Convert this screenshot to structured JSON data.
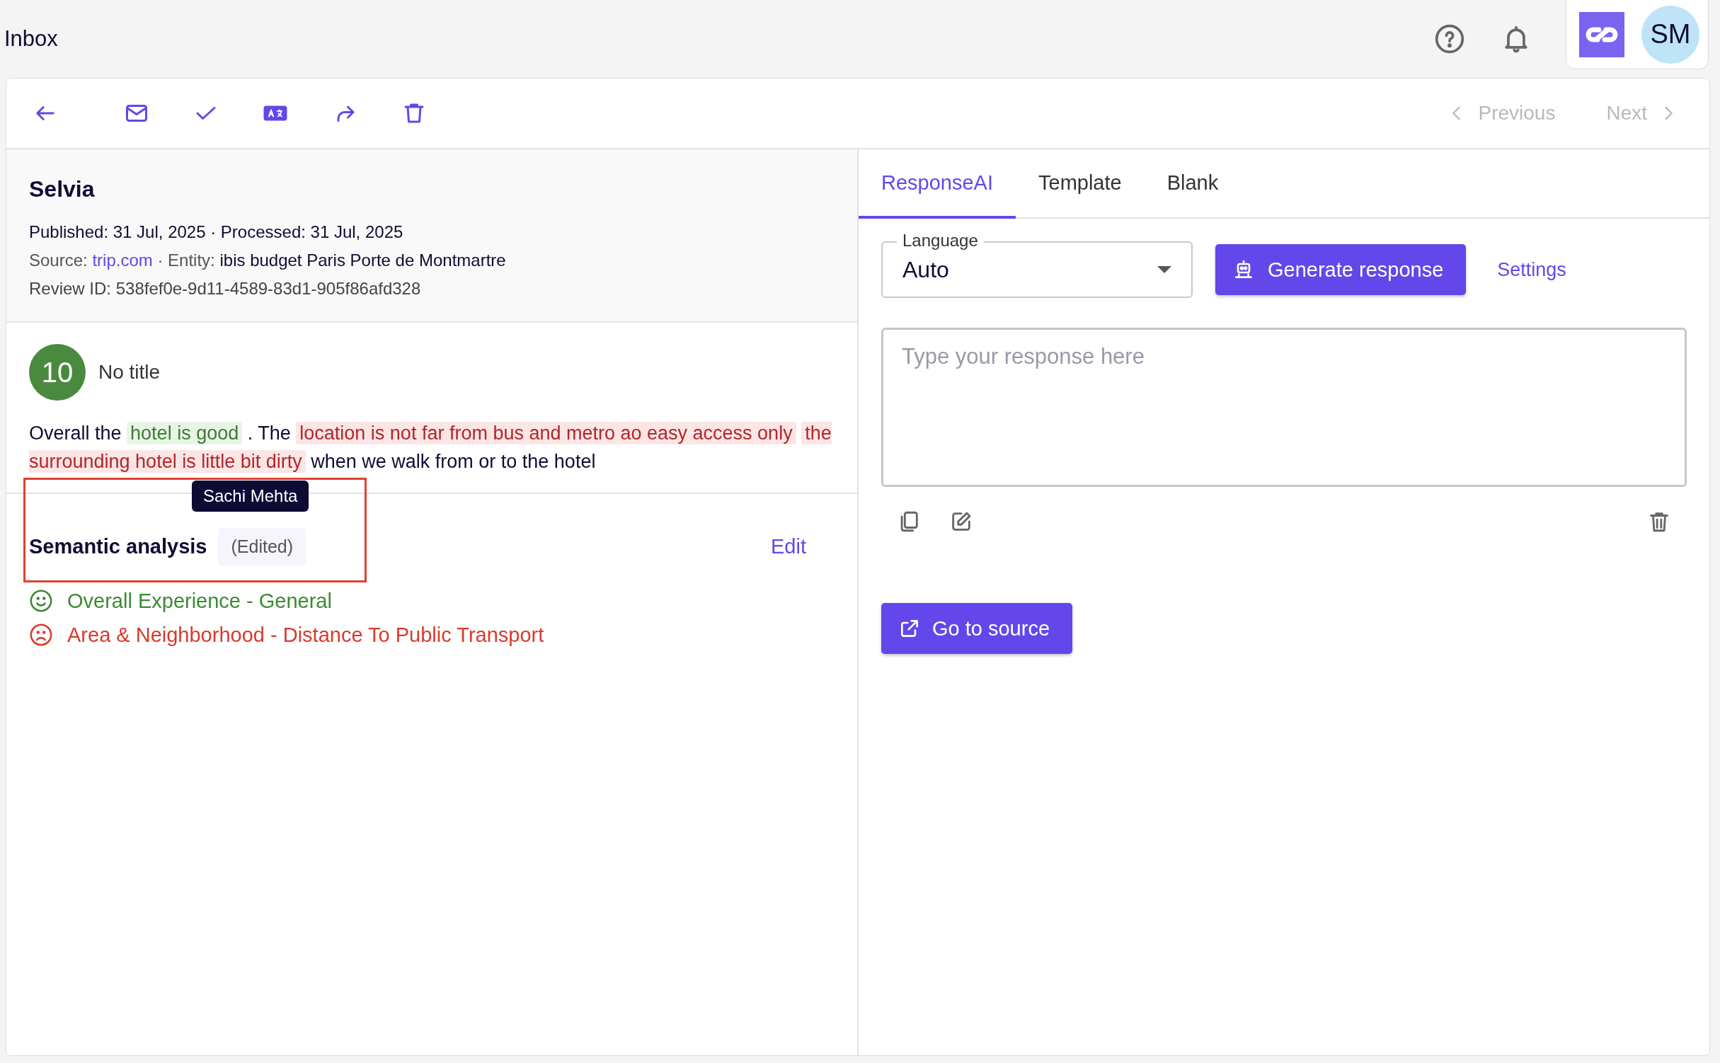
{
  "header": {
    "title": "Inbox",
    "avatar": {
      "initials": "SM"
    }
  },
  "toolbar": {
    "previous": {
      "label": "Previous",
      "disabled": true
    },
    "next": {
      "label": "Next",
      "disabled": true
    }
  },
  "review": {
    "author": "Selvia",
    "dates": "Published: 31 Jul, 2025 · Processed: 31 Jul, 2025",
    "source_label": "Source:",
    "source_link": "trip.com",
    "entity_label": "· Entity:",
    "entity": "ibis budget Paris Porte de Montmartre",
    "review_id": "Review ID: 538fef0e-9d11-4589-83d1-905f86afd328",
    "score": "10",
    "title": "No title",
    "segments": [
      {
        "text": "Overall the",
        "kind": "plain"
      },
      {
        "text": "hotel is good",
        "kind": "positive"
      },
      {
        "text": ". The",
        "kind": "plain"
      },
      {
        "text": "location is not far from bus and metro ao easy access only",
        "kind": "negative"
      },
      {
        "text": "the surrounding hotel is little bit dirty",
        "kind": "negative"
      },
      {
        "text": "when we walk from or to the hotel",
        "kind": "plain"
      }
    ],
    "tooltip": "Sachi Mehta"
  },
  "semantic": {
    "title": "Semantic analysis",
    "badge": "(Edited)",
    "edit": "Edit",
    "topics": [
      {
        "label": "Overall Experience - General",
        "kind": "positive"
      },
      {
        "label": "Area & Neighborhood - Distance To Public Transport",
        "kind": "negative"
      }
    ]
  },
  "response": {
    "tabs": [
      {
        "label": "ResponseAI",
        "selected": true
      },
      {
        "label": "Template",
        "selected": false
      },
      {
        "label": "Blank",
        "selected": false
      }
    ],
    "language": {
      "label": "Language",
      "value": "Auto"
    },
    "generate": "Generate response",
    "settings": "Settings",
    "placeholder": "Type your response here",
    "go_to_source": "Go to source"
  }
}
